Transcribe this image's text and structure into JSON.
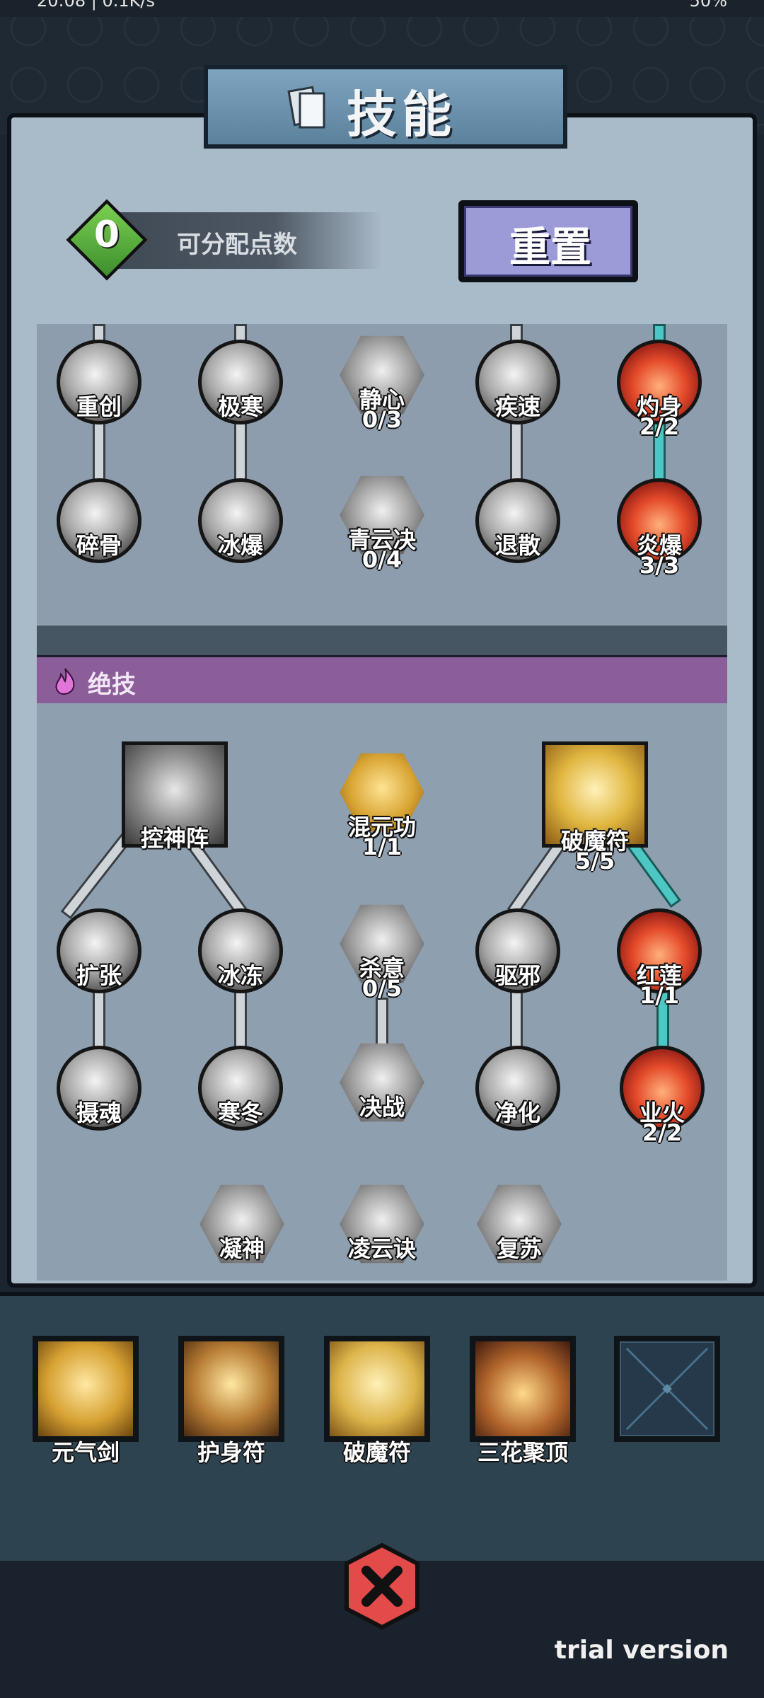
{
  "status_bar": {
    "left": "20:08 | 0.1K/s",
    "right": "50%"
  },
  "title": "技能",
  "points": {
    "value": "0",
    "label": "可分配点数"
  },
  "reset_label": "重置",
  "ultimate_header": "绝技",
  "upper_skills": [
    {
      "name": "重创",
      "level": ""
    },
    {
      "name": "极寒",
      "level": ""
    },
    {
      "name": "静心",
      "level": "0/3"
    },
    {
      "name": "疾速",
      "level": ""
    },
    {
      "name": "灼身",
      "level": "2/2"
    },
    {
      "name": "碎骨",
      "level": ""
    },
    {
      "name": "冰爆",
      "level": ""
    },
    {
      "name": "青云决",
      "level": "0/4"
    },
    {
      "name": "退散",
      "level": ""
    },
    {
      "name": "炎爆",
      "level": "3/3"
    }
  ],
  "lower_skills": [
    {
      "name": "控神阵",
      "level": ""
    },
    {
      "name": "混元功",
      "level": "1/1"
    },
    {
      "name": "破魔符",
      "level": "5/5"
    },
    {
      "name": "扩张",
      "level": ""
    },
    {
      "name": "冰冻",
      "level": ""
    },
    {
      "name": "杀意",
      "level": "0/5"
    },
    {
      "name": "驱邪",
      "level": ""
    },
    {
      "name": "红莲",
      "level": "1/1"
    },
    {
      "name": "摄魂",
      "level": ""
    },
    {
      "name": "寒冬",
      "level": ""
    },
    {
      "name": "决战",
      "level": ""
    },
    {
      "name": "净化",
      "level": ""
    },
    {
      "name": "业火",
      "level": "2/2"
    },
    {
      "name": "凝神",
      "level": ""
    },
    {
      "name": "凌云诀",
      "level": ""
    },
    {
      "name": "复苏",
      "level": ""
    }
  ],
  "equipped": [
    {
      "name": "元气剑"
    },
    {
      "name": "护身符"
    },
    {
      "name": "破魔符"
    },
    {
      "name": "三花聚顶"
    },
    {
      "name": ""
    }
  ],
  "watermark": "trial version",
  "colors": {
    "active_link": "#4cc7c3",
    "points_badge": "#5ab43c",
    "reset_button": "#9d9ad8",
    "ultimate_band": "#8c5e99"
  }
}
